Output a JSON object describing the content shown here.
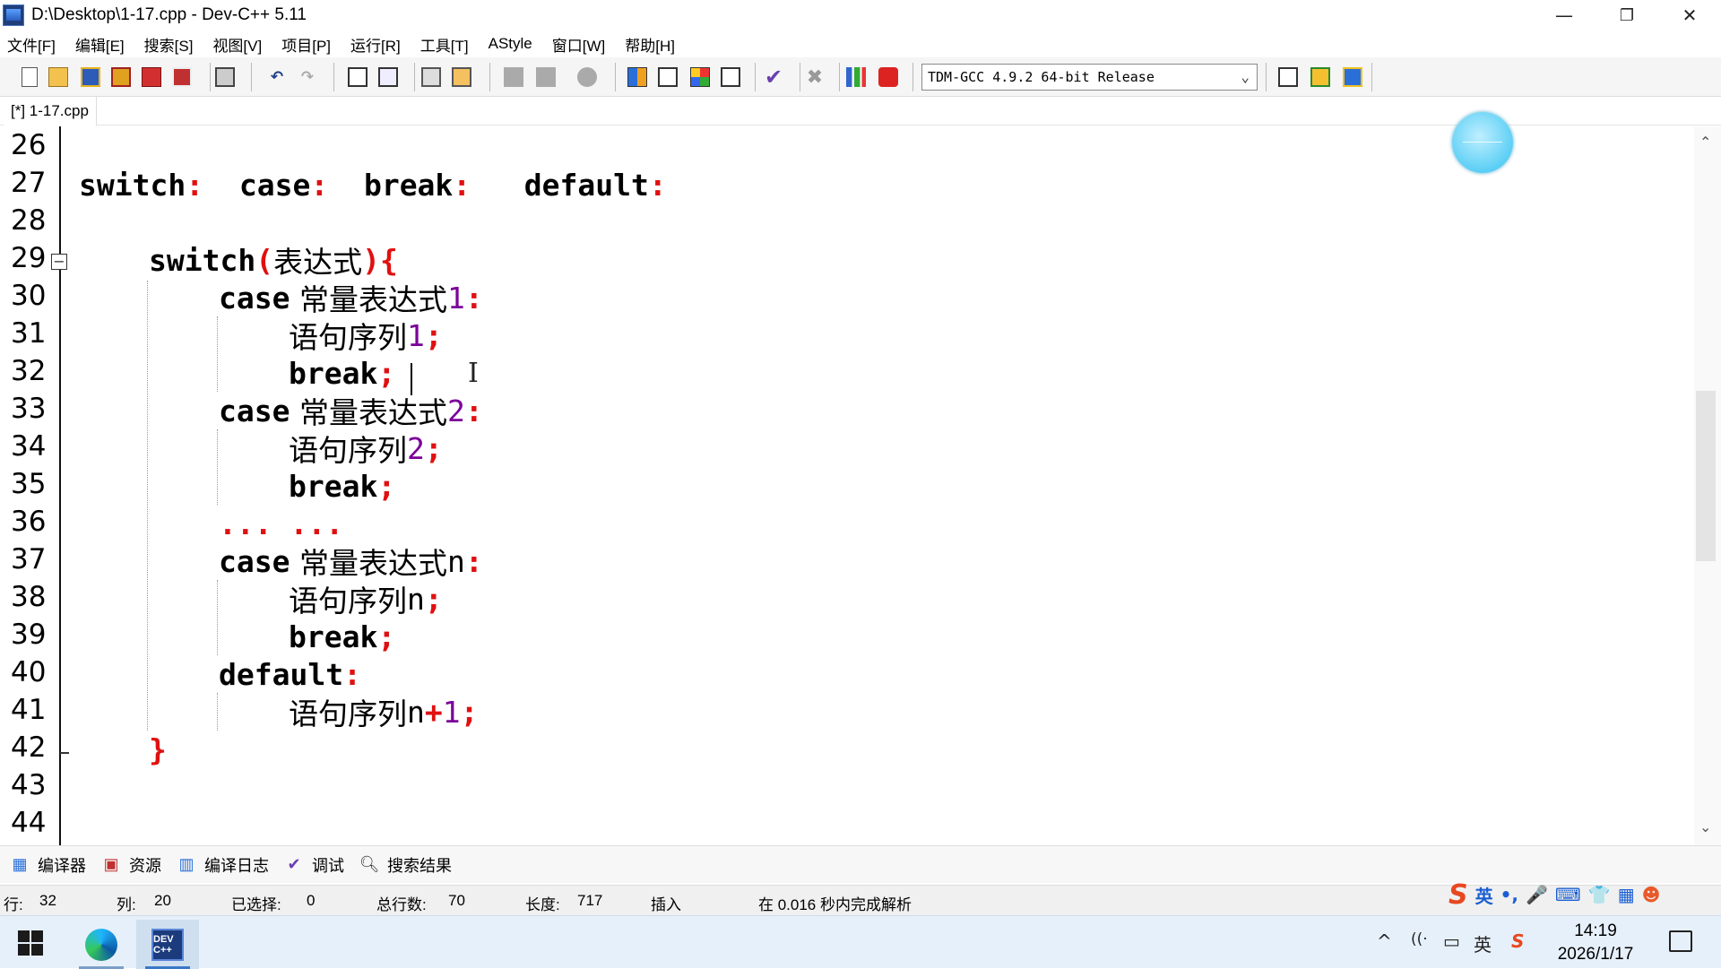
{
  "window": {
    "title": "D:\\Desktop\\1-17.cpp - Dev-C++ 5.11",
    "minimize": "—",
    "restore": "❐",
    "close": "✕"
  },
  "menu": [
    "文件[F]",
    "编辑[E]",
    "搜索[S]",
    "视图[V]",
    "项目[P]",
    "运行[R]",
    "工具[T]",
    "AStyle",
    "窗口[W]",
    "帮助[H]"
  ],
  "toolbar": {
    "compiler": "TDM-GCC 4.9.2 64-bit Release",
    "compiler_arrow": "⌄"
  },
  "tab": {
    "label": "[*] 1-17.cpp"
  },
  "editor": {
    "line_numbers": [
      "26",
      "27",
      "28",
      "29",
      "30",
      "31",
      "32",
      "33",
      "34",
      "35",
      "36",
      "37",
      "38",
      "39",
      "40",
      "41",
      "42",
      "43",
      "44"
    ],
    "fold_symbol": "−",
    "ibeam": "I",
    "code": {
      "l27": {
        "a": "switch",
        "b": ":",
        "c": "case",
        "d": ":",
        "e": "break",
        "f": ":",
        "g": "default",
        "h": ":"
      },
      "l29": {
        "a": "switch",
        "b": "(",
        "c": "表达式",
        "d": "){"
      },
      "l30": {
        "a": "case",
        "b": " 常量表达式",
        "c": "1",
        "d": ":"
      },
      "l31": {
        "a": "语句序列",
        "b": "1",
        "c": ";"
      },
      "l32": {
        "a": "break",
        "b": ";"
      },
      "l33": {
        "a": "case",
        "b": " 常量表达式",
        "c": "2",
        "d": ":"
      },
      "l34": {
        "a": "语句序列",
        "b": "2",
        "c": ";"
      },
      "l35": {
        "a": "break",
        "b": ";"
      },
      "l36": {
        "a": "... ..."
      },
      "l37": {
        "a": "case",
        "b": " 常量表达式",
        "c": "n",
        "d": ":"
      },
      "l38": {
        "a": "语句序列",
        "b": "n",
        "c": ";"
      },
      "l39": {
        "a": "break",
        "b": ";"
      },
      "l40": {
        "a": "default",
        "b": ":"
      },
      "l41": {
        "a": "语句序列",
        "b": "n",
        "c": "+",
        "d": "1",
        "e": ";"
      },
      "l42": {
        "a": "}"
      }
    },
    "scroll_up": "⌃",
    "scroll_down": "⌄"
  },
  "bottom_tabs": [
    "编译器",
    "资源",
    "编译日志",
    "调试",
    "搜索结果"
  ],
  "status": {
    "row_label": "行:",
    "row": "32",
    "col_label": "列:",
    "col": "20",
    "sel_label": "已选择:",
    "sel": "0",
    "lines_label": "总行数:",
    "lines": "70",
    "len_label": "长度:",
    "len": "717",
    "mode": "插入",
    "parse": "在 0.016 秒内完成解析"
  },
  "ime": {
    "logo": "S",
    "lang": "英",
    "punct": "•,",
    "mic": "🎤",
    "kb": "⌨",
    "skin": "👕",
    "grid": "▦",
    "face": "☻"
  },
  "taskbar": {
    "dev_label": "DEV C++",
    "tray_up": "^",
    "wifi": "((·",
    "battery": "▭",
    "ime": "英",
    "sogou": "S",
    "time": "14:19",
    "date": "2026/1/17"
  }
}
